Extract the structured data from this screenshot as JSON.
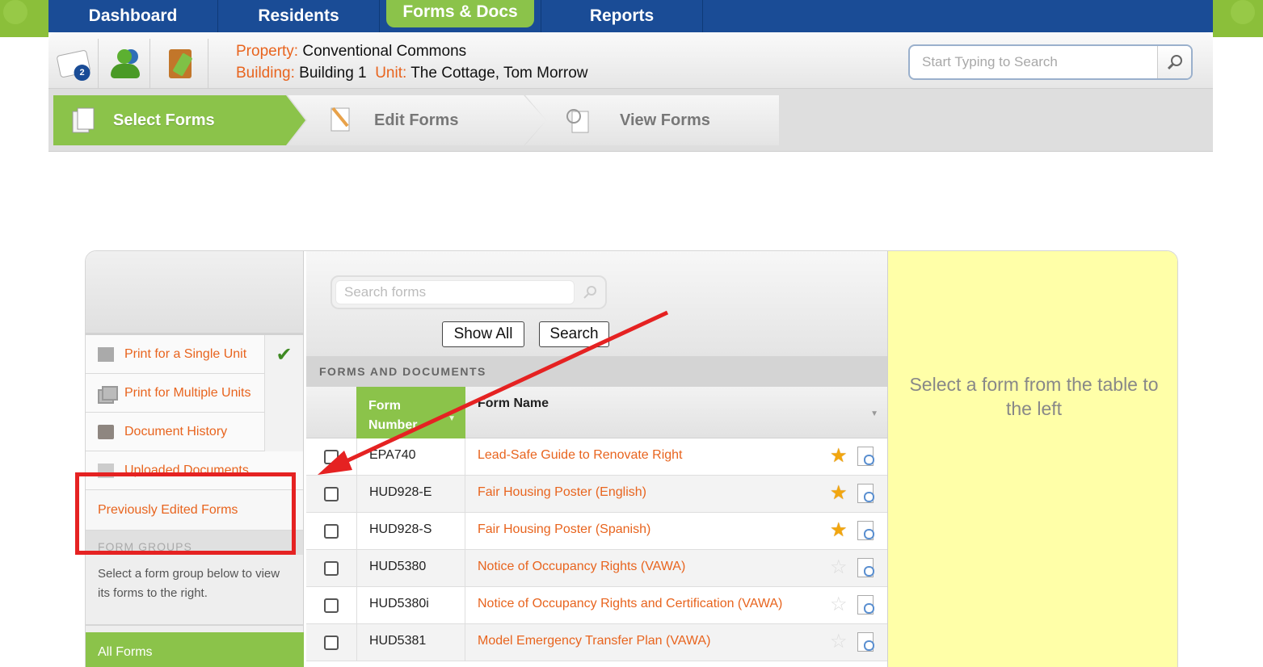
{
  "topnav": {
    "items": [
      {
        "label": "Dashboard"
      },
      {
        "label": "Residents"
      },
      {
        "label": "Forms & Docs",
        "active": true
      },
      {
        "label": "Reports"
      }
    ]
  },
  "header": {
    "message_count": "2",
    "property_label": "Property:",
    "property_value": "Conventional Commons",
    "building_label": "Building:",
    "building_value": "Building 1",
    "unit_label": "Unit:",
    "unit_value": "The Cottage, Tom Morrow",
    "search_placeholder": "Start Typing to Search"
  },
  "steps": [
    {
      "label": "Select Forms",
      "active": true
    },
    {
      "label": "Edit Forms",
      "active": false
    },
    {
      "label": "View Forms",
      "active": false
    }
  ],
  "sidebar": {
    "items": [
      {
        "label": "Print for a Single Unit",
        "checked": true
      },
      {
        "label": "Print for Multiple Units"
      },
      {
        "label": "Document History"
      },
      {
        "label": "Uploaded Documents"
      }
    ],
    "previously_edited": "Previously Edited Forms",
    "form_groups_header": "FORM GROUPS",
    "form_groups_desc": "Select a form group below to view its forms to the right.",
    "all_forms": "All Forms"
  },
  "forms": {
    "search_placeholder": "Search forms",
    "show_all_label": "Show All",
    "search_label": "Search",
    "section_header": "FORMS AND DOCUMENTS",
    "col_number": "Form Number",
    "col_name": "Form Name",
    "rows": [
      {
        "number": "EPA740",
        "name": "Lead-Safe Guide to Renovate Right",
        "favorite": true
      },
      {
        "number": "HUD928-E",
        "name": "Fair Housing Poster (English)",
        "favorite": true
      },
      {
        "number": "HUD928-S",
        "name": "Fair Housing Poster (Spanish)",
        "favorite": true
      },
      {
        "number": "HUD5380",
        "name": "Notice of Occupancy Rights (VAWA)",
        "favorite": false
      },
      {
        "number": "HUD5380i",
        "name": "Notice of Occupancy Rights and Certification (VAWA)",
        "favorite": false
      },
      {
        "number": "HUD5381",
        "name": "Model Emergency Transfer Plan (VAWA)",
        "favorite": false
      }
    ]
  },
  "preview": {
    "placeholder": "Select a form from the table to the left"
  },
  "colors": {
    "nav_blue": "#1a4c96",
    "brand_green": "#8bc34a",
    "link_orange": "#e8641e",
    "preview_yellow": "#ffffa8",
    "annotation_red": "#e52222"
  }
}
